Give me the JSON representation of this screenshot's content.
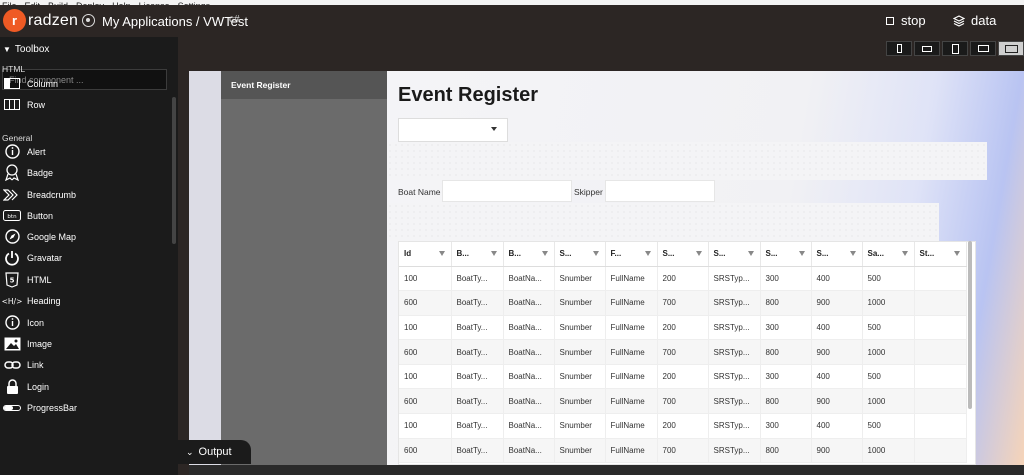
{
  "menubar": [
    "File",
    "Edit",
    "Build",
    "Deploy",
    "Help",
    "License",
    "Settings"
  ],
  "header": {
    "brand": "radzen",
    "logo_letter": "r",
    "app_path": "My Applications / VWTest",
    "lang_badge": "c#",
    "stop_label": "stop",
    "data_label": "data"
  },
  "toolbox": {
    "title": "Toolbox",
    "search_placeholder": "Find component ...",
    "sections": [
      {
        "label": "HTML",
        "items": [
          {
            "label": "Column",
            "icon": "column-icon"
          },
          {
            "label": "Row",
            "icon": "row-icon"
          }
        ]
      },
      {
        "label": "General",
        "items": [
          {
            "label": "Alert",
            "icon": "info-icon"
          },
          {
            "label": "Badge",
            "icon": "badge-icon"
          },
          {
            "label": "Breadcrumb",
            "icon": "breadcrumb-icon"
          },
          {
            "label": "Button",
            "icon": "button-icon"
          },
          {
            "label": "Google Map",
            "icon": "compass-icon"
          },
          {
            "label": "Gravatar",
            "icon": "power-icon"
          },
          {
            "label": "HTML",
            "icon": "html5-icon"
          },
          {
            "label": "Heading",
            "icon": "heading-icon"
          },
          {
            "label": "Icon",
            "icon": "info-icon"
          },
          {
            "label": "Image",
            "icon": "image-icon"
          },
          {
            "label": "Link",
            "icon": "link-icon"
          },
          {
            "label": "Login",
            "icon": "lock-icon"
          },
          {
            "label": "ProgressBar",
            "icon": "progress-icon"
          }
        ]
      }
    ]
  },
  "output_tab": "Output",
  "page": {
    "nav_item": "Event Register",
    "title": "Event Register",
    "boat_name_label": "Boat Name",
    "skipper_label": "Skipper"
  },
  "grid": {
    "columns": [
      "Id",
      "B...",
      "B...",
      "S...",
      "F...",
      "S...",
      "S...",
      "S...",
      "S...",
      "Sa...",
      "St..."
    ],
    "rows": [
      [
        "100",
        "BoatTy...",
        "BoatNa...",
        "Snumber",
        "FullName",
        "200",
        "SRSTyp...",
        "300",
        "400",
        "500",
        ""
      ],
      [
        "600",
        "BoatTy...",
        "BoatNa...",
        "Snumber",
        "FullName",
        "700",
        "SRSTyp...",
        "800",
        "900",
        "1000",
        ""
      ],
      [
        "100",
        "BoatTy...",
        "BoatNa...",
        "Snumber",
        "FullName",
        "200",
        "SRSTyp...",
        "300",
        "400",
        "500",
        ""
      ],
      [
        "600",
        "BoatTy...",
        "BoatNa...",
        "Snumber",
        "FullName",
        "700",
        "SRSTyp...",
        "800",
        "900",
        "1000",
        ""
      ],
      [
        "100",
        "BoatTy...",
        "BoatNa...",
        "Snumber",
        "FullName",
        "200",
        "SRSTyp...",
        "300",
        "400",
        "500",
        ""
      ],
      [
        "600",
        "BoatTy...",
        "BoatNa...",
        "Snumber",
        "FullName",
        "700",
        "SRSTyp...",
        "800",
        "900",
        "1000",
        ""
      ],
      [
        "100",
        "BoatTy...",
        "BoatNa...",
        "Snumber",
        "FullName",
        "200",
        "SRSTyp...",
        "300",
        "400",
        "500",
        ""
      ],
      [
        "600",
        "BoatTy...",
        "BoatNa...",
        "Snumber",
        "FullName",
        "700",
        "SRSTyp...",
        "800",
        "900",
        "1000",
        ""
      ]
    ]
  },
  "colors": {
    "brand": "#ef5a24",
    "topbar": "#2c2624",
    "sidebar": "#1b1b1b"
  }
}
